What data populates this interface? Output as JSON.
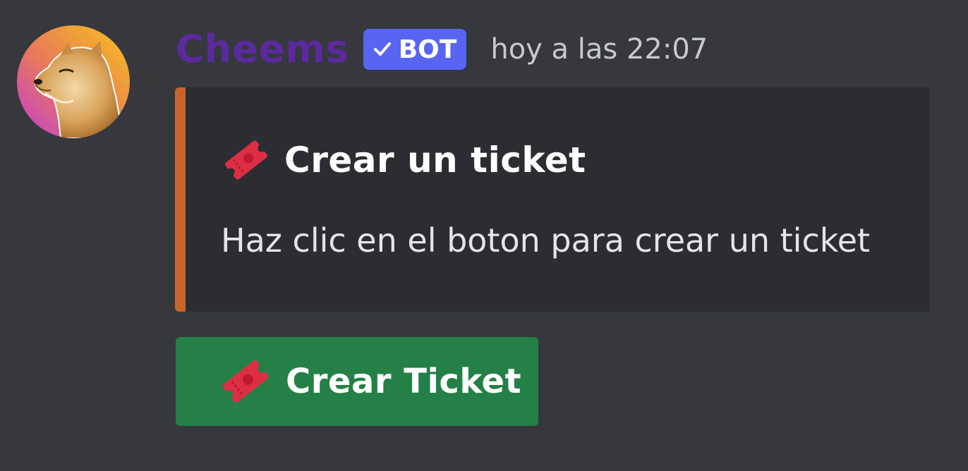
{
  "message": {
    "author": {
      "name": "Cheems",
      "badge": "BOT",
      "avatar_icon": "cheems-dog-avatar",
      "name_color": "#5b2a9e"
    },
    "timestamp": "hoy a las 22:07",
    "embed": {
      "accent_color": "#c8642a",
      "title_icon": "ticket-emoji",
      "title": "Crear un ticket",
      "description": "Haz clic en el boton para crear un ticket"
    },
    "button": {
      "icon": "ticket-emoji",
      "label": "Crear Ticket",
      "color": "#248046"
    }
  },
  "colors": {
    "background": "#36383d",
    "embed_background": "#2c2d32",
    "badge": "#5865f2"
  }
}
